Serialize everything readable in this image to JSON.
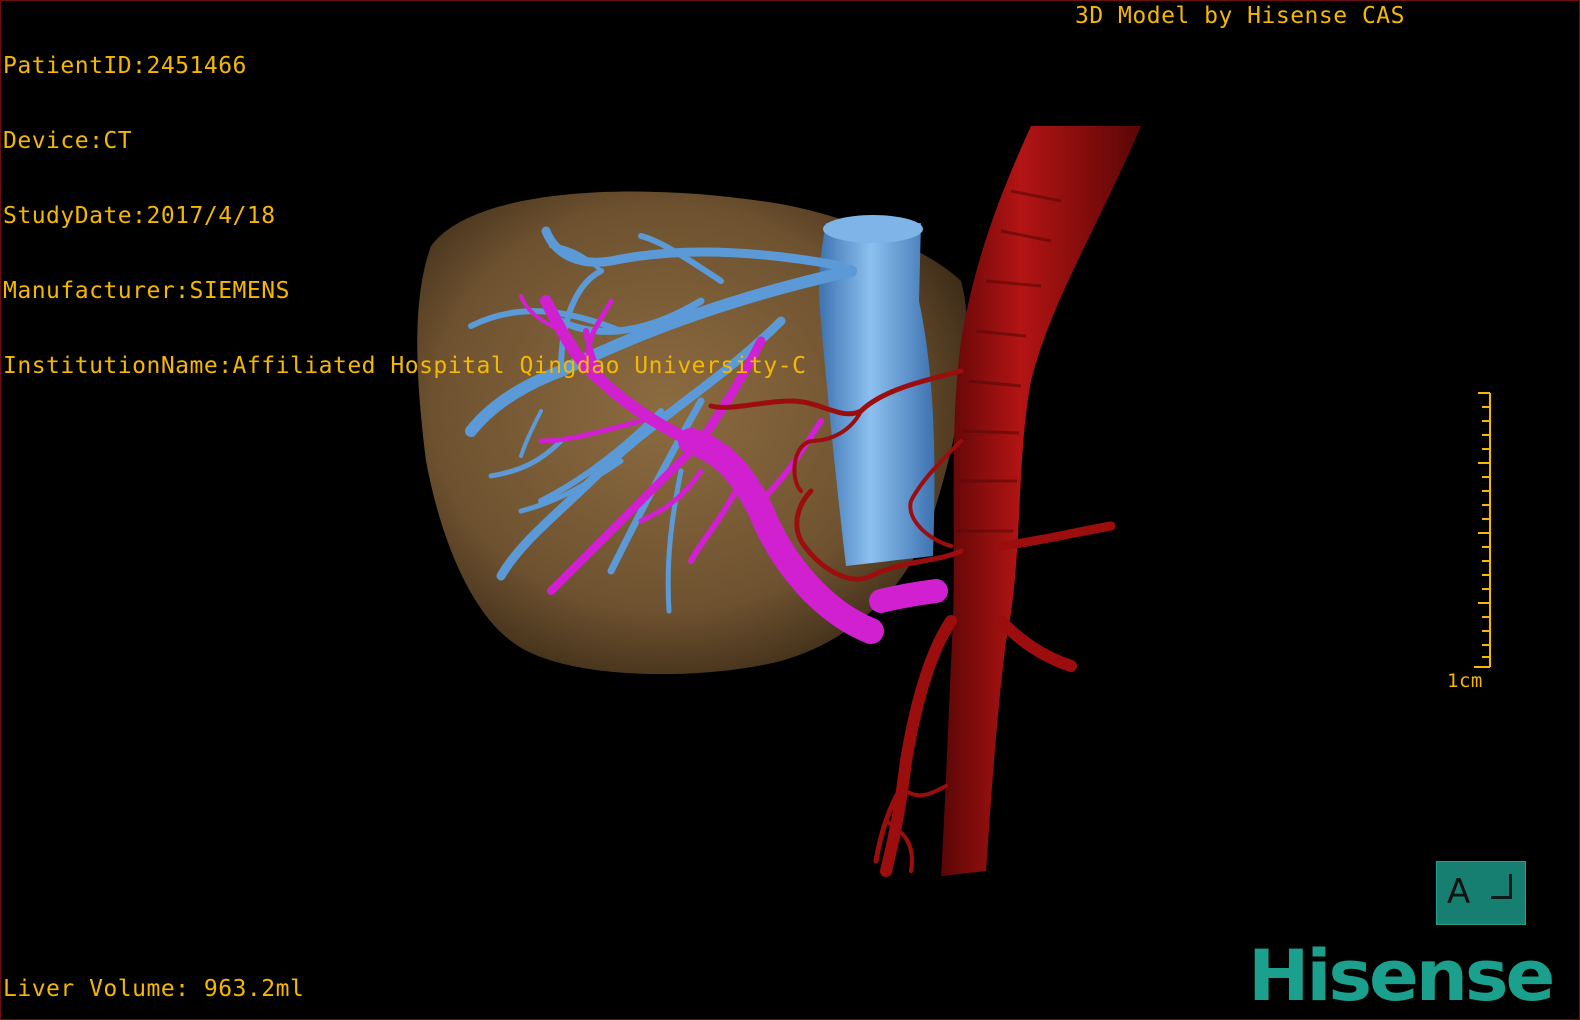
{
  "dicom_info": {
    "patient_id": "PatientID:2451466",
    "device": "Device:CT",
    "study_date": "StudyDate:2017/4/18",
    "manufacturer": "Manufacturer:SIEMENS",
    "institution": "InstitutionName:Affiliated Hospital Qingdao University-C"
  },
  "caption": "3D Model by Hisense CAS",
  "liver_volume": "Liver Volume: 963.2ml",
  "scale_bar": {
    "label": "1cm"
  },
  "orientation": {
    "letter": "A",
    "icon": "orientation-cube-icon"
  },
  "logo_text": "Hisense",
  "colors": {
    "overlay_text": "#f5b800",
    "liver": "#8a6a40",
    "hepatic_vein": "#5b9ad6",
    "portal_vein": "#d020d0",
    "artery": "#9c0e0e",
    "brand": "#1aa08d"
  }
}
